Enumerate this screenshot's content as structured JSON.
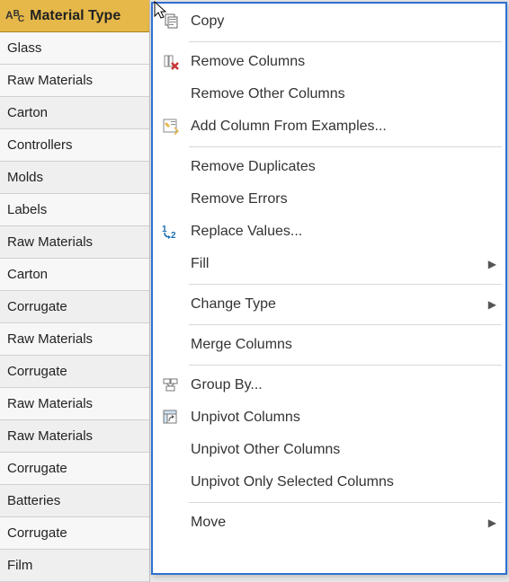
{
  "column": {
    "type_label": "ABC",
    "title": "Material Type",
    "rows": [
      "Glass",
      "Raw Materials",
      "Carton",
      "Controllers",
      "Molds",
      "Labels",
      "Raw Materials",
      "Carton",
      "Corrugate",
      "Raw Materials",
      "Corrugate",
      "Raw Materials",
      "Raw Materials",
      "Corrugate",
      "Batteries",
      "Corrugate",
      "Film"
    ]
  },
  "menu": {
    "items": [
      {
        "icon": "copy-icon",
        "label": "Copy",
        "submenu": false
      },
      {
        "separator": true
      },
      {
        "icon": "remove-columns-icon",
        "label": "Remove Columns",
        "submenu": false
      },
      {
        "icon": "",
        "label": "Remove Other Columns",
        "submenu": false
      },
      {
        "icon": "add-column-icon",
        "label": "Add Column From Examples...",
        "submenu": false
      },
      {
        "separator": true
      },
      {
        "icon": "",
        "label": "Remove Duplicates",
        "submenu": false
      },
      {
        "icon": "",
        "label": "Remove Errors",
        "submenu": false
      },
      {
        "icon": "replace-values-icon",
        "label": "Replace Values...",
        "submenu": false
      },
      {
        "icon": "",
        "label": "Fill",
        "submenu": true
      },
      {
        "separator": true
      },
      {
        "icon": "",
        "label": "Change Type",
        "submenu": true
      },
      {
        "separator": true
      },
      {
        "icon": "",
        "label": "Merge Columns",
        "submenu": false
      },
      {
        "separator": true
      },
      {
        "icon": "group-by-icon",
        "label": "Group By...",
        "submenu": false
      },
      {
        "icon": "unpivot-icon",
        "label": "Unpivot Columns",
        "submenu": false
      },
      {
        "icon": "",
        "label": "Unpivot Other Columns",
        "submenu": false
      },
      {
        "icon": "",
        "label": "Unpivot Only Selected Columns",
        "submenu": false
      },
      {
        "separator": true
      },
      {
        "icon": "",
        "label": "Move",
        "submenu": true
      }
    ]
  }
}
